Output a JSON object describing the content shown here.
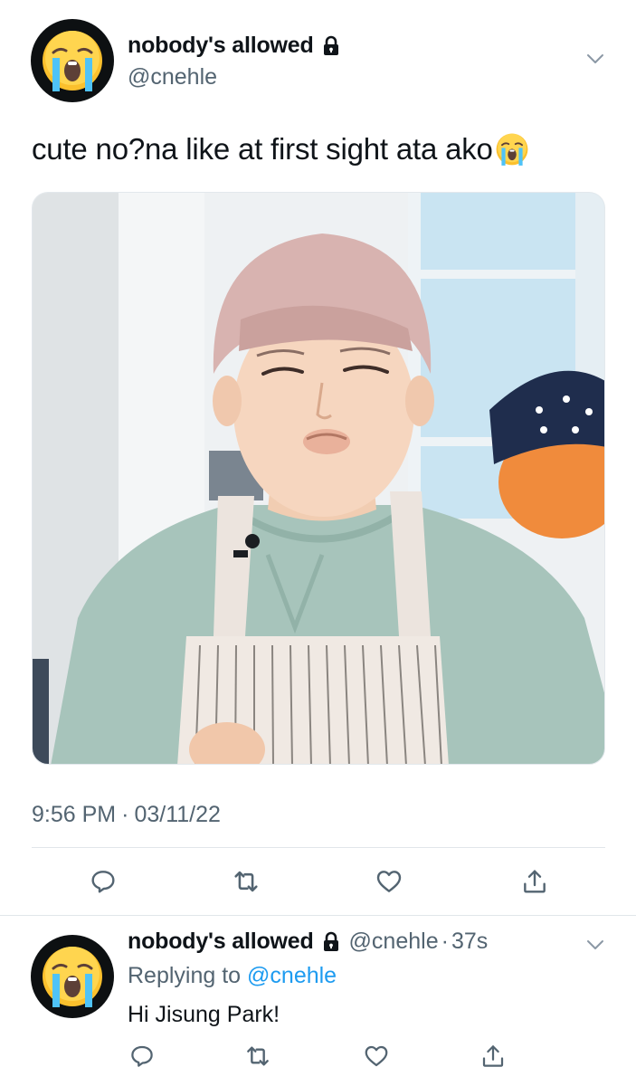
{
  "tweet": {
    "author": {
      "display_name": "nobody's allowed",
      "handle": "@cnehle",
      "avatar_icon": "loudly-crying-face-icon",
      "protected_icon": "lock-icon"
    },
    "text": "cute no?na like at first sight ata ako",
    "text_emoji": "loudly-crying-face-icon",
    "media_description": "photo",
    "time": "9:56 PM",
    "separator": "·",
    "date": "03/11/22",
    "actions": [
      "reply-icon",
      "retweet-icon",
      "like-icon",
      "share-icon"
    ]
  },
  "reply": {
    "author": {
      "display_name": "nobody's allowed",
      "handle": "@cnehle",
      "avatar_icon": "loudly-crying-face-icon",
      "protected_icon": "lock-icon"
    },
    "separator": "·",
    "age": "37s",
    "replying_prefix": "Replying to",
    "replying_mention": "@cnehle",
    "text": "Hi Jisung Park!",
    "actions": [
      "reply-icon",
      "retweet-icon",
      "like-icon",
      "share-icon"
    ]
  },
  "colors": {
    "text": "#0f1419",
    "secondary": "#536471",
    "link": "#1d9bf0",
    "divider": "#e1e6ea"
  }
}
